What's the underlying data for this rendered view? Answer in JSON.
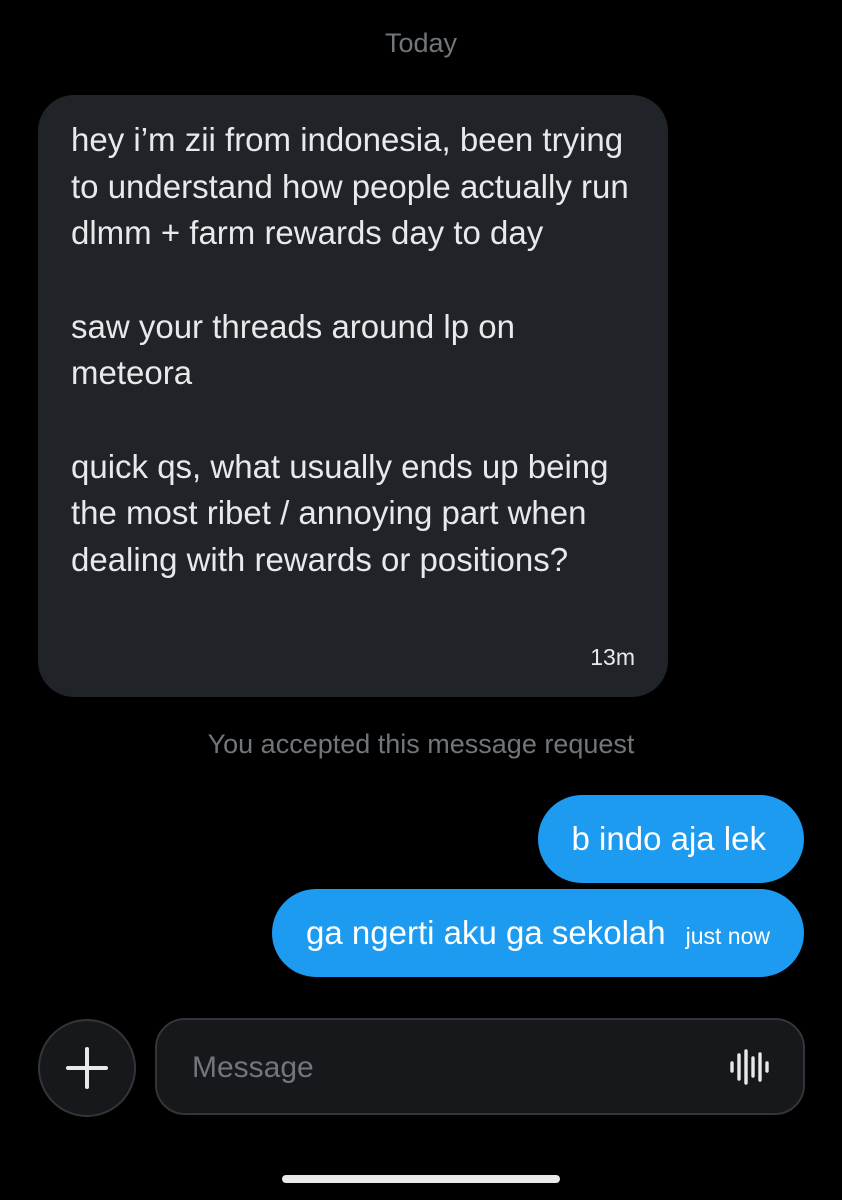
{
  "conversation": {
    "date_label": "Today",
    "incoming_message": {
      "paragraphs": [
        "hey i’m zii from indonesia, been trying to understand how people actually run dlmm + farm rewards day to day",
        "saw your threads around lp on meteora",
        "quick qs, what usually ends up being the most ribet / annoying part when dealing with rewards or positions?"
      ],
      "time": "13m"
    },
    "system_note": "You accepted this message request",
    "outgoing_messages": [
      {
        "text": "b indo aja lek",
        "time": ""
      },
      {
        "text": "ga ngerti aku ga sekolah",
        "time": "just now"
      }
    ]
  },
  "composer": {
    "placeholder": "Message",
    "add_icon": "plus-icon",
    "voice_icon": "voice-waveform-icon"
  },
  "colors": {
    "background": "#000000",
    "incoming_bubble": "#202327",
    "outgoing_bubble": "#1d9bf0",
    "secondary_text": "#71767b",
    "primary_text": "#e7e9ea"
  }
}
